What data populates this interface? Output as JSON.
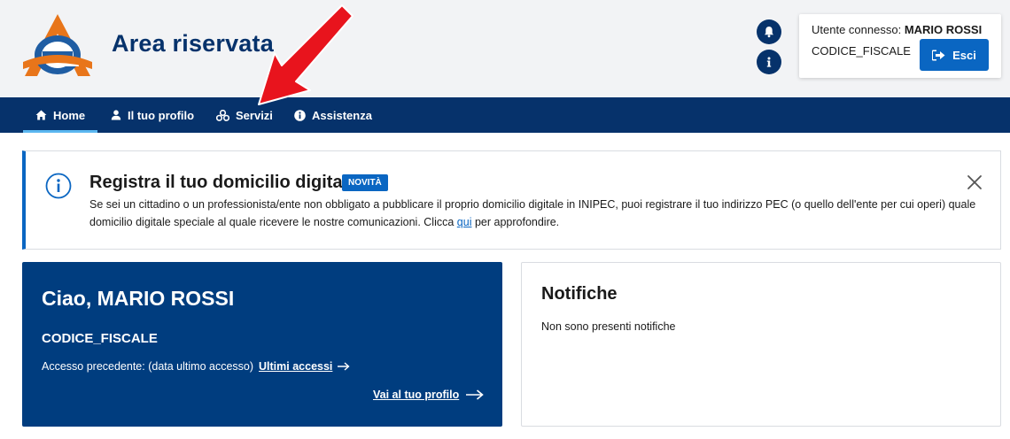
{
  "header": {
    "title": "Area riservata",
    "logo_icon": "agenzia-entrate-logo",
    "bell_icon": "bell-icon",
    "info_icon": "info-icon"
  },
  "user": {
    "label": "Utente connesso:",
    "name": "MARIO ROSSI",
    "codice_fiscale": "CODICE_FISCALE",
    "logout_label": "Esci"
  },
  "nav": {
    "items": [
      {
        "label": "Home",
        "icon": "home-icon",
        "active": true
      },
      {
        "label": "Il tuo profilo",
        "icon": "user-icon"
      },
      {
        "label": "Servizi",
        "icon": "services-icon"
      },
      {
        "label": "Assistenza",
        "icon": "info-icon"
      }
    ]
  },
  "banner": {
    "title": "Registra il tuo domicilio digitale",
    "badge": "NOVITÀ",
    "text_before": "Se sei un cittadino o un professionista/ente non obbligato a pubblicare il proprio domicilio digitale in INIPEC, puoi registrare il tuo indirizzo PEC (o quello dell'ente per cui operi) quale domicilio digitale speciale al quale ricevere le nostre comunicazioni. Clicca ",
    "link": "qui",
    "text_after": " per approfondire."
  },
  "welcome": {
    "greeting": "Ciao, MARIO ROSSI",
    "codice_fiscale": "CODICE_FISCALE",
    "access_label": "Accesso precedente: (data ultimo accesso)",
    "access_link": "Ultimi accessi",
    "profile_link": "Vai al tuo profilo"
  },
  "notifications": {
    "title": "Notifiche",
    "empty_text": "Non sono presenti notifiche"
  },
  "colors": {
    "primary_dark": "#06326b",
    "card_blue": "#003d7f",
    "accent": "#0a66c2",
    "annotation_arrow": "#e8141d"
  }
}
